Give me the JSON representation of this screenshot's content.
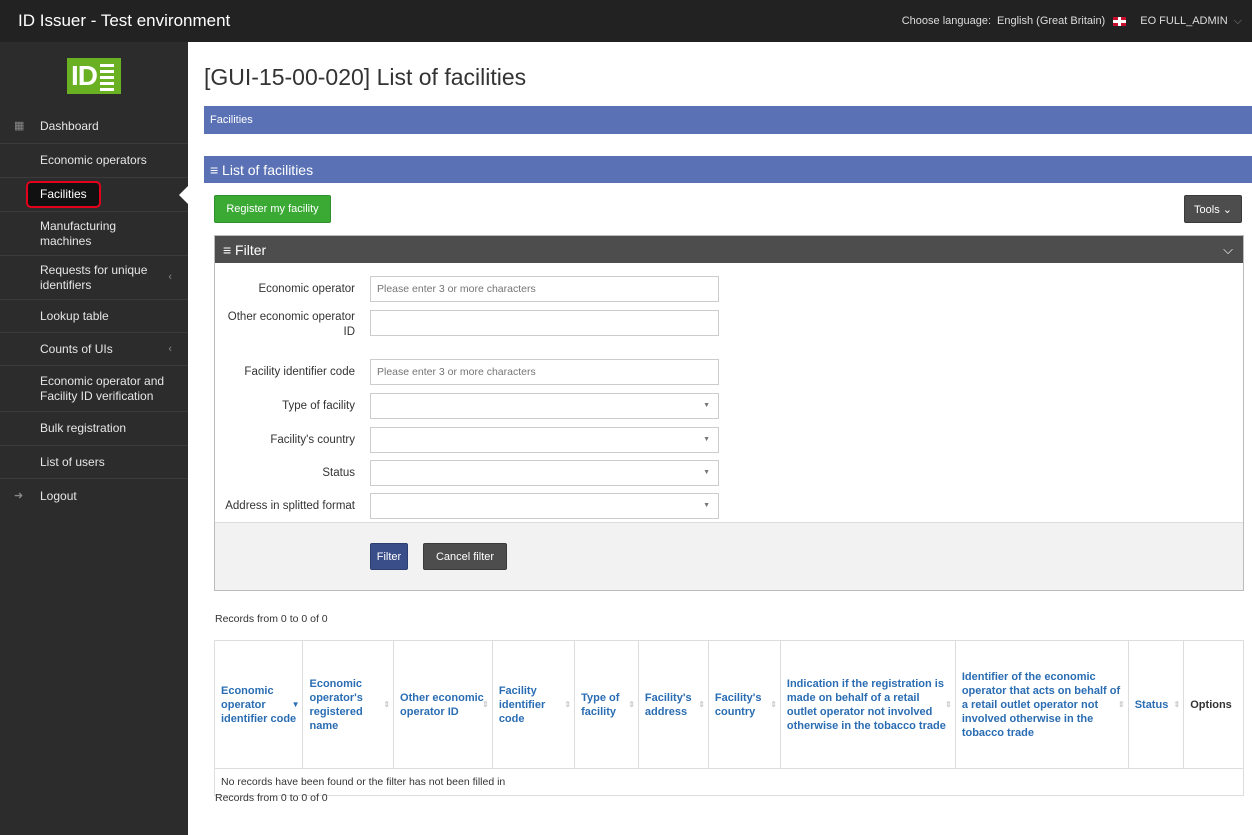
{
  "topbar": {
    "title": "ID Issuer - Test environment",
    "lang_label": "Choose language:",
    "lang_value": "English (Great Britain)",
    "user": "EO FULL_ADMIN",
    "user_chev": "⌵"
  },
  "logo_text": "ID",
  "sidebar": {
    "items": [
      {
        "label": "Dashboard",
        "icon": "dashboard-icon"
      },
      {
        "label": "Economic operators"
      },
      {
        "label": "Facilities"
      },
      {
        "label": "Manufacturing machines"
      },
      {
        "label": "Requests for unique identifiers"
      },
      {
        "label": "Lookup table"
      },
      {
        "label": "Counts of UIs"
      },
      {
        "label": "Economic operator and Facility ID verification"
      },
      {
        "label": "Bulk registration"
      },
      {
        "label": "List of users"
      },
      {
        "label": "Logout",
        "icon": "logout-icon"
      }
    ]
  },
  "page": {
    "title": "[GUI-15-00-020] List of facilities",
    "breadcrumb": "Facilities",
    "panel_title": "≡ List of facilities",
    "register_btn": "Register my facility",
    "tools_btn": "Tools ⌄"
  },
  "filter": {
    "title": "≡ Filter",
    "fields": {
      "economic_operator": {
        "label": "Economic operator",
        "placeholder": "Please enter 3 or more characters"
      },
      "other_eo_id": {
        "label": "Other economic operator ID",
        "value": ""
      },
      "facility_id_code": {
        "label": "Facility identifier code",
        "placeholder": "Please enter 3 or more characters"
      },
      "type_of_facility": {
        "label": "Type of facility",
        "value": ""
      },
      "facility_country": {
        "label": "Facility's country",
        "value": ""
      },
      "status": {
        "label": "Status",
        "value": ""
      },
      "address_split": {
        "label": "Address in splitted format",
        "value": ""
      }
    },
    "filter_btn": "Filter",
    "cancel_btn": "Cancel filter"
  },
  "records_label": "Records from 0 to 0 of 0",
  "table": {
    "columns": [
      "Economic operator identifier code",
      "Economic operator's registered name",
      "Other economic operator ID",
      "Facility identifier code",
      "Type of facility",
      "Facility's address",
      "Facility's country",
      "Indication if the registration is made on behalf of a retail outlet operator not involved otherwise in the tobacco trade",
      "Identifier of the economic operator that acts on behalf of a retail outlet operator not involved otherwise in the tobacco trade",
      "Status",
      "Options"
    ],
    "empty_message": "No records have been found or the filter has not been filled in"
  },
  "colors": {
    "topbar": "#222222",
    "sidebar": "#2c2c2c",
    "panel_blue": "#5a72b5",
    "green_button": "#3aaa35",
    "highlight_red": "#e2001a"
  }
}
